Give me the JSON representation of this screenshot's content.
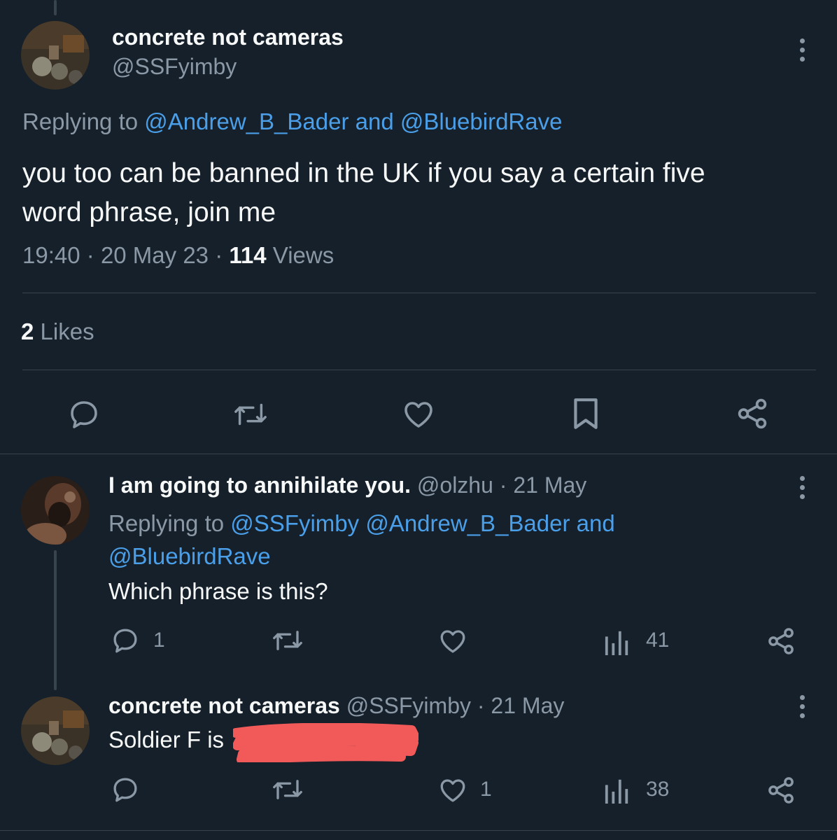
{
  "tweet": {
    "author_name": "concrete not cameras",
    "author_handle": "@SSFyimby",
    "replying_prefix": "Replying to",
    "reply_target_1": "@Andrew_B_Bader",
    "reply_conjunction": "and",
    "reply_target_2": "@BluebirdRave",
    "text_line1": "you too can be banned in the UK if you say a certain five",
    "text_line2": "word phrase, join me",
    "time": "19:40",
    "sep": "·",
    "date": "20 May 23",
    "views_count": "114",
    "views_label": "Views",
    "likes_count": "2",
    "likes_label": "Likes"
  },
  "reply1": {
    "author_name": "I am going to annihilate you.",
    "handle_date": "@olzhu · 21 May",
    "replying_prefix": "Replying to",
    "reply_target_1": "@SSFyimby",
    "reply_target_2": "@Andrew_B_Bader",
    "reply_conjunction": "and",
    "reply_target_3": "@BluebirdRave",
    "text": "Which phrase is this?",
    "reply_count": "1",
    "views_count": "41"
  },
  "reply2": {
    "author_name": "concrete not cameras",
    "handle_date": "@SSFyimby · 21 May",
    "text": "Soldier F is",
    "like_count": "1",
    "views_count": "38"
  },
  "colors": {
    "background": "#15202b",
    "text": "#f7f9f9",
    "muted": "#8b98a5",
    "link": "#4a9fe8",
    "redaction": "#f25a5a"
  }
}
